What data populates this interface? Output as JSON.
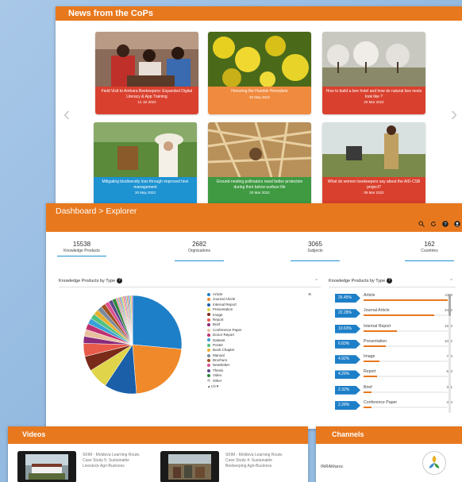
{
  "news": {
    "title": "News from the CoPs",
    "prev_icon": "chevron-left-icon",
    "next_icon": "chevron-right-icon",
    "cards": [
      {
        "title": "Field Visit to Amhara Beekeepers: Expanded Digital Literacy & App Training",
        "date": "12 Jul 2022",
        "color": "#d9412e"
      },
      {
        "title": "Honoring the Humble Honeybee",
        "date": "20 May 2022",
        "color": "#f08a3e"
      },
      {
        "title": "How to build a bee hotel and how do natural bee nests look like ?",
        "date": "20 Mar 2022",
        "color": "#d9412e"
      },
      {
        "title": "Mitigating biodiversity loss through improved hive management",
        "date": "20 May 2022",
        "color": "#1d93d2"
      },
      {
        "title": "Ground-nesting pollinators need better protection during their below-surface life",
        "date": "20 Mar 2022",
        "color": "#3f9a42"
      },
      {
        "title": "What do women beekeepers say about the AID-CSB project?",
        "date": "08 Mar 2022",
        "color": "#d9412e"
      }
    ]
  },
  "dashboard": {
    "title": "Dashboard > Explorer",
    "icons": [
      "search-icon",
      "refresh-icon",
      "help-icon",
      "user-icon"
    ],
    "stats": [
      {
        "value": "15538",
        "label": "Knowledge Products"
      },
      {
        "value": "2682",
        "label": "Orgnizations"
      },
      {
        "value": "3065",
        "label": "Subjects"
      },
      {
        "value": "162",
        "label": "Countries"
      }
    ],
    "left_section": {
      "title": "Knowledge Products by Type",
      "caret": "^"
    },
    "right_section": {
      "title": "Knowledge Products by Type",
      "caret": "^"
    },
    "menu_icon": "≡",
    "legend": [
      {
        "name": "Article",
        "color": "#1d7fc8"
      },
      {
        "name": "Journal Article",
        "color": "#f0892a"
      },
      {
        "name": "Internal Report",
        "color": "#1a5fa8"
      },
      {
        "name": "Presentation",
        "color": "#e0d44a"
      },
      {
        "name": "Image",
        "color": "#7a2a18"
      },
      {
        "name": "Report",
        "color": "#e85a4a"
      },
      {
        "name": "Brief",
        "color": "#8a2a7a"
      },
      {
        "name": "Conference Paper",
        "color": "#e8c0a0"
      },
      {
        "name": "Donor Report",
        "color": "#c03070"
      },
      {
        "name": "Dataset",
        "color": "#3aa0d8"
      },
      {
        "name": "Poster",
        "color": "#50c080"
      },
      {
        "name": "Book Chapter",
        "color": "#e8b030"
      },
      {
        "name": "Manual",
        "color": "#7a8a9a"
      },
      {
        "name": "Brochure",
        "color": "#a05020"
      },
      {
        "name": "Newsletter",
        "color": "#e05090"
      },
      {
        "name": "Thesis",
        "color": "#5a4a8a"
      },
      {
        "name": "Video",
        "color": "#2a8a3a"
      },
      {
        "name": "Other",
        "color": "#c8c8c8"
      }
    ],
    "legend_pager": "▲1/8▼",
    "rows": [
      {
        "pct": "26.45%",
        "label": "Article",
        "value": "4110",
        "frac": 1.0
      },
      {
        "pct": "22.28%",
        "label": "Journal Article",
        "value": "3462",
        "frac": 0.84
      },
      {
        "pct": "10.63%",
        "label": "Internal Report",
        "value": "1652",
        "frac": 0.4
      },
      {
        "pct": "6.83%",
        "label": "Presentation",
        "value": "1062",
        "frac": 0.26
      },
      {
        "pct": "4.92%",
        "label": "Image",
        "value": "764",
        "frac": 0.19
      },
      {
        "pct": "4.29%",
        "label": "Report",
        "value": "666",
        "frac": 0.16
      },
      {
        "pct": "2.32%",
        "label": "Brief",
        "value": "361",
        "frac": 0.09
      },
      {
        "pct": "2.28%",
        "label": "Conference Paper",
        "value": "354",
        "frac": 0.09
      }
    ]
  },
  "chart_data": {
    "type": "pie",
    "title": "Knowledge Products by Type",
    "categories": [
      "Article",
      "Journal Article",
      "Internal Report",
      "Presentation",
      "Image",
      "Report",
      "Brief",
      "Conference Paper",
      "Donor Report",
      "Dataset",
      "Poster",
      "Book Chapter",
      "Manual",
      "Brochure",
      "Newsletter",
      "Thesis",
      "Video",
      "Other"
    ],
    "values": [
      26.45,
      22.28,
      10.63,
      6.83,
      4.92,
      4.29,
      2.32,
      2.28,
      2.0,
      1.9,
      1.8,
      1.7,
      1.6,
      1.5,
      1.4,
      1.3,
      1.2,
      5.59
    ],
    "legend": "right"
  },
  "videos": {
    "title": "Videos",
    "items": [
      {
        "title": "SKIM - Moldova Learning Route, Case Study 5: Sustainable Livestock Agri-Business"
      },
      {
        "title": "SKIM - Moldova Learning Route, Case Study 4: Sustainable Beekeeping Agri-Business"
      }
    ]
  },
  "channels": {
    "title": "Channels",
    "items": [
      {
        "name": "INRAMaroc"
      }
    ]
  }
}
